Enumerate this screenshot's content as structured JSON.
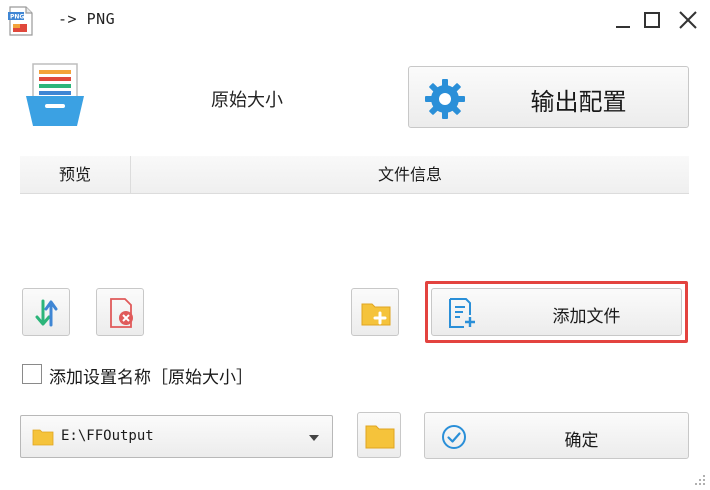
{
  "window": {
    "title": "-> PNG",
    "controls": {
      "minimize": "minimize",
      "maximize": "maximize",
      "close": "close"
    }
  },
  "top": {
    "size_label": "原始大小",
    "output_button_label": "输出配置"
  },
  "list": {
    "columns": [
      "预览",
      "文件信息"
    ],
    "rows": []
  },
  "actions": {
    "add_file_label": "添加文件"
  },
  "options": {
    "add_setting_name_label": "添加设置名称［原始大小］",
    "add_setting_name_checked": false
  },
  "bottom": {
    "output_path": "E:\\FFOutput",
    "ok_label": "确定"
  },
  "colors": {
    "accent_blue": "#2a8fd8",
    "highlight_red": "#e3433f",
    "folder_yellow": "#f5c33b",
    "delete_red": "#e05a5a",
    "sort_green": "#2cb57a"
  }
}
